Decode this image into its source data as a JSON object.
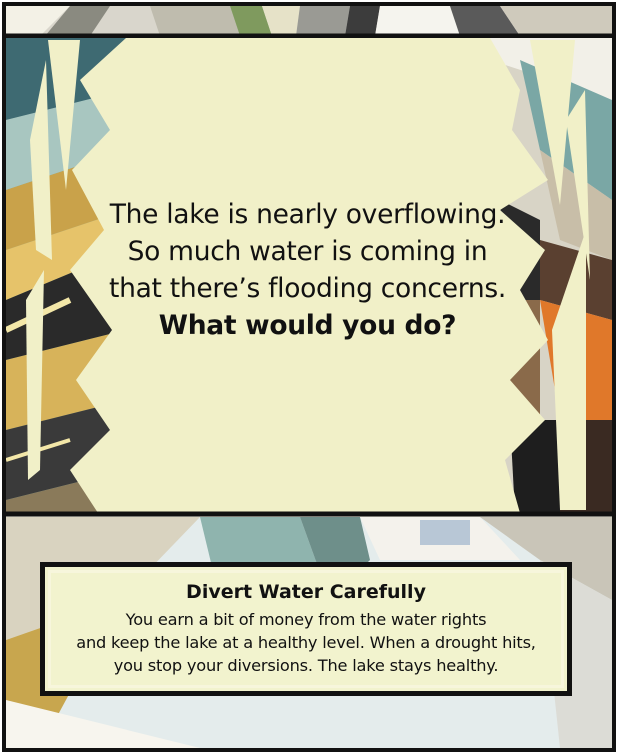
{
  "colors": {
    "panel": "#f1f0c8",
    "border": "#111111",
    "background": "#ffffff"
  },
  "scenario": {
    "lines": [
      "The lake is nearly overflowing.",
      "So much water is coming in",
      "that there’s flooding concerns."
    ],
    "question": "What would you do?"
  },
  "choice": {
    "title": "Divert Water Carefully",
    "lines": [
      "You earn a bit of money from the water rights",
      "and keep the lake at a healthy level. When a drought hits,",
      "you stop your diversions. The lake stays healthy."
    ]
  }
}
